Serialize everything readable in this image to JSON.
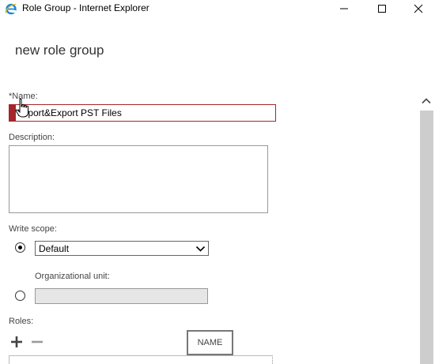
{
  "window": {
    "title": "Role Group - Internet Explorer"
  },
  "page": {
    "title": "new role group"
  },
  "form": {
    "name_label": "*Name:",
    "name_value": "Import&Export PST Files",
    "description_label": "Description:",
    "description_value": "",
    "write_scope_label": "Write scope:",
    "write_scope_selected": "Default",
    "org_unit_label": "Organizational unit:",
    "org_unit_value": "",
    "roles_label": "Roles:",
    "roles_column_header": "NAME"
  },
  "colors": {
    "error_accent": "#a4262c",
    "scrollbar_thumb": "#cdcdcd",
    "disabled_field": "#e6e6e6"
  },
  "icons": [
    "internet-explorer-icon",
    "minimize-icon",
    "maximize-icon",
    "close-icon",
    "chevron-down-icon",
    "add-icon",
    "remove-icon",
    "chevron-up-icon",
    "hand-cursor-icon"
  ]
}
